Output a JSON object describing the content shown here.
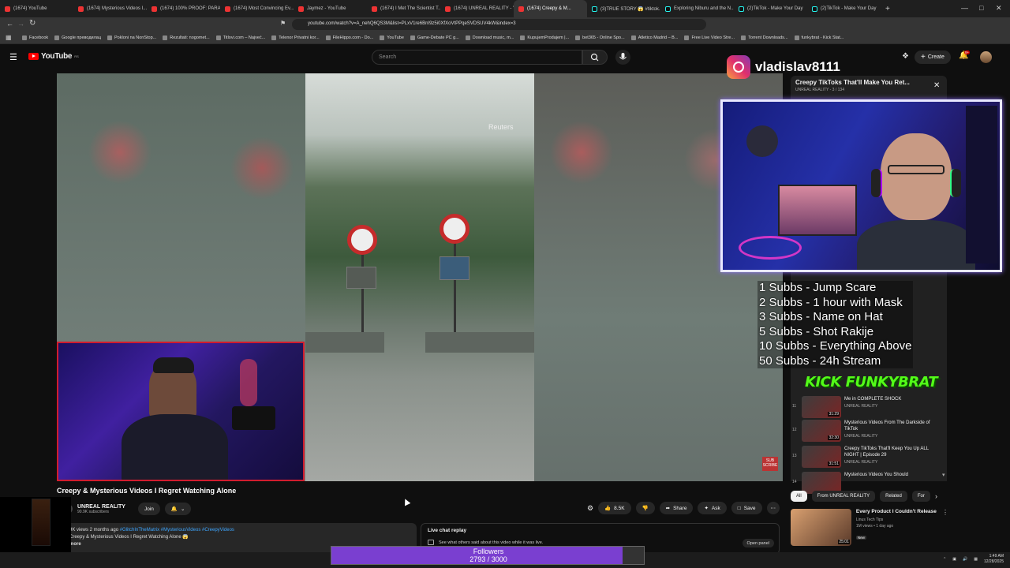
{
  "browser": {
    "tabs": [
      {
        "label": "(1674) YouTube",
        "type": "yt"
      },
      {
        "label": "(1674) Mysterious Videos I...",
        "type": "yt"
      },
      {
        "label": "(1674) 100% PROOF: PARA...",
        "type": "yt"
      },
      {
        "label": "(1674) Most Convincing Ev...",
        "type": "yt"
      },
      {
        "label": "Jaymez - YouTube",
        "type": "yt"
      },
      {
        "label": "(1674) I Met The Scientist T...",
        "type": "yt"
      },
      {
        "label": "(1674) UNREAL REALITY - Y...",
        "type": "yt"
      },
      {
        "label": "(1674) Creepy & M...",
        "type": "yt",
        "active": true
      },
      {
        "label": "(3)TRUE STORY 😱 #tiktok...",
        "type": "tt"
      },
      {
        "label": "Exploring Niburu and the N...",
        "type": "tt"
      },
      {
        "label": "(2)TikTok - Make Your Day",
        "type": "tt"
      },
      {
        "label": "(2)TikTok - Make Your Day",
        "type": "tt"
      }
    ],
    "url": "youtube.com/watch?v=A_nehQ6QS3M&list=PLxV1re6BnI9z5i0XfXoVtPPqeSVDSUV4kW&index=3",
    "bookmarks": [
      "Facebook",
      "Google преводилац",
      "Pokloni na NonStop...",
      "Rezultati: nogomet...",
      "Titlovi.com – Najveć...",
      "Telenor Privatni kor...",
      "FileHippo.com - Do...",
      "YouTube",
      "Game-Debate PC g...",
      "Download music, m...",
      "KupujemProdajem |...",
      "bet365 - Online Spo...",
      "Atletico Madrid – B...",
      "Free Live Video Stre...",
      "Torrent Downloads...",
      "funkybrat - Kick Stat..."
    ]
  },
  "youtube": {
    "logo_text": "YouTube",
    "region": "RS",
    "search_placeholder": "Search",
    "create_label": "Create",
    "notif_count": "9+"
  },
  "video": {
    "watermark": "Reuters",
    "title": "Creepy & Mysterious Videos I Regret Watching Alone",
    "channel": "UNREAL REALITY",
    "subscribers": "90.9K subscribers",
    "join_label": "Join",
    "likes": "8.5K",
    "share_label": "Share",
    "ask_label": "Ask",
    "save_label": "Save",
    "sub_badge": "SUB SCRIBE"
  },
  "description": {
    "meta": "9K views  2 months ago",
    "tags": "#GlitchInTheMatrix #MysteriousVideos #CreepyVideos",
    "line2": "Creepy & Mysterious Videos I Regret Watching Alone 😱",
    "more": "more"
  },
  "live_chat": {
    "title": "Live chat replay",
    "subtitle": "See what others said about this video while it was live.",
    "open_panel": "Open panel"
  },
  "followers": {
    "label": "Followers",
    "count_text": "2793 / 3000",
    "progress": 0.931
  },
  "streamer": {
    "instagram": "vladislav8111",
    "kick_badge": "KICK FUNKYBRAT"
  },
  "goals": [
    "1 Subbs - Jump Scare",
    "2 Subbs - 1 hour with Mask",
    "3 Subbs - Name on Hat",
    "5 Subbs - Shot Rakije",
    "10 Subbs - Everything Above",
    "50 Subbs - 24h Stream"
  ],
  "playlist": {
    "title": "Creepy TikToks That'll Make You Ret...",
    "subtitle": "UNREAL REALITY - 3 / 134",
    "items": [
      {
        "num": "11",
        "title": "Me in COMPLETE SHOCK",
        "channel": "UNREAL REALITY",
        "duration": "31:29"
      },
      {
        "num": "12",
        "title": "Mysterious Videos From The Darkside of TikTok",
        "channel": "UNREAL REALITY",
        "duration": "32:30"
      },
      {
        "num": "13",
        "title": "Creepy TikToks That'll Keep You Up ALL NIGHT | Episode 29",
        "channel": "UNREAL REALITY",
        "duration": "31:51"
      },
      {
        "num": "14",
        "title": "Mysterious Videos You Should",
        "channel": "",
        "duration": ""
      }
    ]
  },
  "chips": [
    "All",
    "From UNREAL REALITY",
    "Related",
    "For"
  ],
  "recommendation": {
    "title": "Every Product I Couldn't Release",
    "channel": "Linus Tech Tips",
    "meta": "1M views • 1 day ago",
    "badge": "New",
    "duration": "25:01"
  },
  "clock": {
    "time": "1:49 AM",
    "date": "12/28/2025"
  }
}
